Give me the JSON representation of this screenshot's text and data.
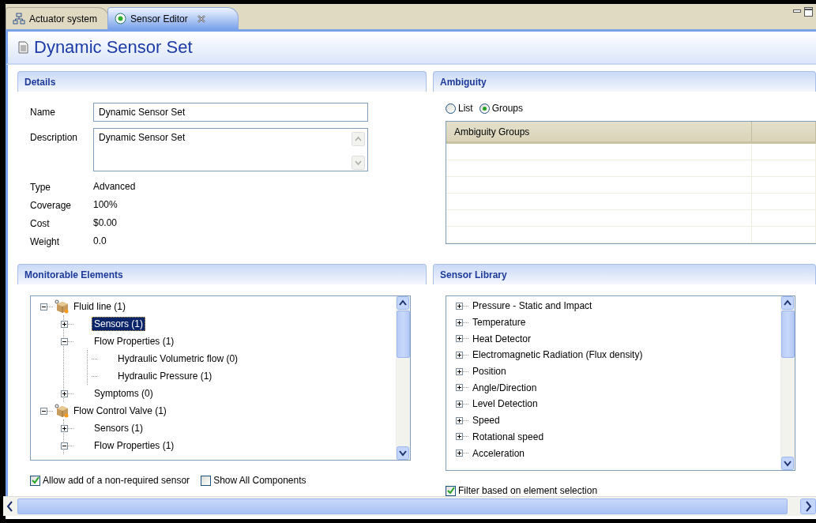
{
  "tabs": [
    {
      "label": "Actuator system",
      "selected": false,
      "closable": false
    },
    {
      "label": "Sensor Editor",
      "selected": true,
      "closable": true
    }
  ],
  "editor": {
    "title": "Dynamic Sensor Set"
  },
  "details": {
    "title": "Details",
    "fields": [
      {
        "label": "Name",
        "kind": "text",
        "value": "Dynamic Sensor Set"
      },
      {
        "label": "Description",
        "kind": "textarea",
        "value": "Dynamic Sensor Set"
      },
      {
        "label": "Type",
        "kind": "static",
        "value": "Advanced"
      },
      {
        "label": "Coverage",
        "kind": "static",
        "value": "100%"
      },
      {
        "label": "Cost",
        "kind": "static",
        "value": "$0.00"
      },
      {
        "label": "Weight",
        "kind": "static",
        "value": "0.0"
      }
    ]
  },
  "ambiguity": {
    "title": "Ambiguity",
    "view_options": [
      {
        "label": "List",
        "selected": false
      },
      {
        "label": "Groups",
        "selected": true
      }
    ],
    "table": {
      "columns": [
        "Ambiguity Groups"
      ]
    }
  },
  "monitorable": {
    "title": "Monitorable Elements",
    "tree": [
      {
        "label": "Fluid line (1)",
        "expanded": true,
        "selected": false,
        "children": [
          {
            "label": "Sensors (1)",
            "expanded": false,
            "selected": true
          },
          {
            "label": "Flow Properties (1)",
            "expanded": true,
            "selected": false,
            "children": [
              {
                "label": "Hydraulic Volumetric flow (0)",
                "selected": false
              },
              {
                "label": "Hydraulic Pressure (1)",
                "selected": false
              }
            ]
          },
          {
            "label": "Symptoms (0)",
            "expanded": false,
            "selected": false
          }
        ]
      },
      {
        "label": "Flow Control Valve (1)",
        "expanded": true,
        "selected": false,
        "children": [
          {
            "label": "Sensors (1)",
            "expanded": false,
            "selected": false
          },
          {
            "label": "Flow Properties (1)",
            "expanded": true,
            "selected": false
          }
        ]
      }
    ],
    "options": [
      {
        "label": "Allow add of a non-required sensor",
        "checked": true
      },
      {
        "label": "Show All Components",
        "checked": false
      }
    ]
  },
  "sensor_library": {
    "title": "Sensor Library",
    "tree": [
      {
        "label": "Pressure - Static and Impact",
        "expanded": false,
        "selected": false
      },
      {
        "label": "Temperature",
        "expanded": false,
        "selected": false
      },
      {
        "label": "Heat Detector",
        "expanded": false,
        "selected": false
      },
      {
        "label": "Electromagnetic Radiation (Flux density)",
        "expanded": false,
        "selected": false
      },
      {
        "label": "Position",
        "expanded": false,
        "selected": false
      },
      {
        "label": "Angle/Direction",
        "expanded": false,
        "selected": false
      },
      {
        "label": "Level Detection",
        "expanded": false,
        "selected": false
      },
      {
        "label": "Speed",
        "expanded": false,
        "selected": false
      },
      {
        "label": "Rotational speed",
        "expanded": false,
        "selected": false
      },
      {
        "label": "Acceleration",
        "expanded": false,
        "selected": false
      }
    ],
    "options": [
      {
        "label": "Filter based on element selection",
        "checked": true
      }
    ]
  }
}
